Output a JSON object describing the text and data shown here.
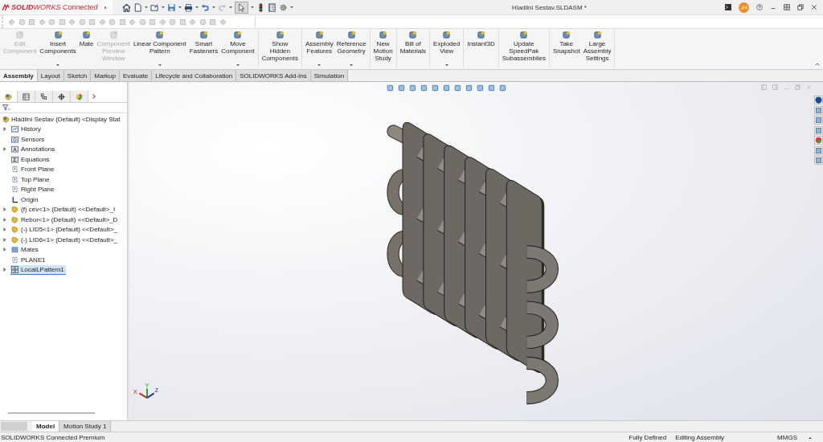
{
  "app": {
    "logo": "**SOLID**WORKS Connected"
  },
  "window": {
    "title": "Hladilni Sestav.SLDASM *",
    "avatar": "JH"
  },
  "ribbon_groups": [
    [
      {
        "lines": [
          "Edit",
          "Component"
        ],
        "disabled": true,
        "dropdown": false
      },
      {
        "lines": [
          "Insert",
          "Components"
        ],
        "disabled": false,
        "dropdown": true
      },
      {
        "lines": [
          "Mate"
        ],
        "disabled": false,
        "dropdown": false
      },
      {
        "lines": [
          "Component",
          "Preview",
          "Window"
        ],
        "disabled": true,
        "dropdown": false
      },
      {
        "lines": [
          "Linear Component",
          "Pattern"
        ],
        "disabled": false,
        "dropdown": true
      },
      {
        "lines": [
          "Smart",
          "Fasteners"
        ],
        "disabled": false,
        "dropdown": false
      },
      {
        "lines": [
          "Move",
          "Component"
        ],
        "disabled": false,
        "dropdown": true
      }
    ],
    [
      {
        "lines": [
          "Show",
          "Hidden",
          "Components"
        ],
        "disabled": false,
        "dropdown": false
      }
    ],
    [
      {
        "lines": [
          "Assembly",
          "Features"
        ],
        "disabled": false,
        "dropdown": true
      },
      {
        "lines": [
          "Reference",
          "Geometry"
        ],
        "disabled": false,
        "dropdown": true
      }
    ],
    [
      {
        "lines": [
          "New",
          "Motion",
          "Study"
        ],
        "disabled": false,
        "dropdown": false
      }
    ],
    [
      {
        "lines": [
          "Bill of",
          "Materials"
        ],
        "disabled": false,
        "dropdown": false
      }
    ],
    [
      {
        "lines": [
          "Exploded",
          "View"
        ],
        "disabled": false,
        "dropdown": true
      }
    ],
    [
      {
        "lines": [
          "Instant3D"
        ],
        "disabled": false,
        "dropdown": false
      }
    ],
    [
      {
        "lines": [
          "Update",
          "SpeedPak",
          "Subassemblies"
        ],
        "disabled": false,
        "dropdown": false
      }
    ],
    [
      {
        "lines": [
          "Take",
          "Snapshot"
        ],
        "disabled": false,
        "dropdown": false
      },
      {
        "lines": [
          "Large",
          "Assembly",
          "Settings"
        ],
        "disabled": false,
        "dropdown": false
      }
    ]
  ],
  "tabs": [
    {
      "label": "Assembly",
      "selected": true
    },
    {
      "label": "Layout",
      "selected": false
    },
    {
      "label": "Sketch",
      "selected": false
    },
    {
      "label": "Markup",
      "selected": false
    },
    {
      "label": "Evaluate",
      "selected": false
    },
    {
      "label": "Lifecycle and Collaboration",
      "selected": false
    },
    {
      "label": "SOLIDWORKS Add-Ins",
      "selected": false
    },
    {
      "label": "Simulation",
      "selected": false
    }
  ],
  "panel_tabs": [
    {
      "kind": "feature-manager",
      "selected": true
    },
    {
      "kind": "property-manager",
      "selected": false
    },
    {
      "kind": "configuration-manager",
      "selected": false
    },
    {
      "kind": "dimxpert",
      "selected": false
    },
    {
      "kind": "display-manager",
      "selected": false
    }
  ],
  "feature_tree": {
    "label": "Hladilni Sestav (Default) <Display Stat",
    "children": [
      {
        "label": "History",
        "kind": "history",
        "expandable": true,
        "selected": false
      },
      {
        "label": "Sensors",
        "kind": "sensors",
        "expandable": false,
        "selected": false
      },
      {
        "label": "Annotations",
        "kind": "annotations",
        "expandable": true,
        "selected": false
      },
      {
        "label": "Equations",
        "kind": "equations",
        "expandable": false,
        "selected": false
      },
      {
        "label": "Front Plane",
        "kind": "plane",
        "expandable": false,
        "selected": false
      },
      {
        "label": "Top Plane",
        "kind": "plane",
        "expandable": false,
        "selected": false
      },
      {
        "label": "Right Plane",
        "kind": "plane",
        "expandable": false,
        "selected": false
      },
      {
        "label": "Origin",
        "kind": "origin",
        "expandable": false,
        "selected": false
      },
      {
        "label": "(f) cev<1> (Default) <<Default>_I",
        "kind": "part",
        "expandable": true,
        "selected": false
      },
      {
        "label": "Rebor<1> (Default) <<Default>_D",
        "kind": "part",
        "expandable": true,
        "selected": false
      },
      {
        "label": "(-) LID5<1> (Default) <<Default>_",
        "kind": "part",
        "expandable": true,
        "selected": false
      },
      {
        "label": "(-) LID6<1> (Default) <<Default>_",
        "kind": "part",
        "expandable": true,
        "selected": false
      },
      {
        "label": "Mates",
        "kind": "mates",
        "expandable": true,
        "selected": false
      },
      {
        "label": "PLANE1",
        "kind": "plane",
        "expandable": false,
        "selected": false
      },
      {
        "label": "LocalLPattern1",
        "kind": "pattern",
        "expandable": true,
        "selected": true
      }
    ]
  },
  "triad": {
    "x": "X",
    "y": "Y",
    "z": "Z"
  },
  "bottom_tabs": [
    {
      "label": "Model",
      "selected": true
    },
    {
      "label": "Motion Study 1",
      "selected": false
    }
  ],
  "status_bar": {
    "product": "SOLIDWORKS Connected Premium",
    "state": "Fully Defined",
    "mode": "Editing Assembly",
    "units": "MMGS"
  }
}
